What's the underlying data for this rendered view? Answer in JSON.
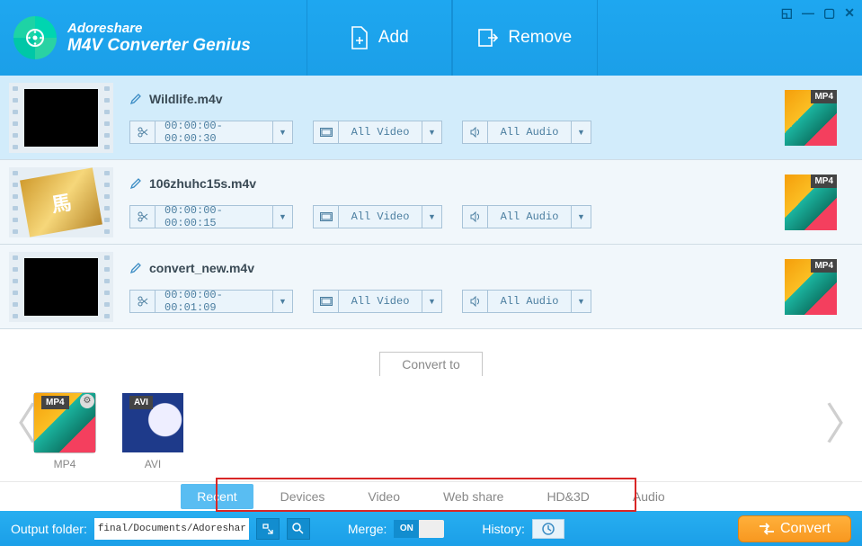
{
  "brand": {
    "line1": "Adoreshare",
    "line2": "M4V Converter Genius"
  },
  "header": {
    "add": "Add",
    "remove": "Remove"
  },
  "files": [
    {
      "name": "Wildlife.m4v",
      "trim": "00:00:00-00:00:30",
      "video": "All Video",
      "audio": "All Audio",
      "format": "MP4",
      "thumb": "black",
      "selected": true
    },
    {
      "name": "106zhuhc15s.m4v",
      "trim": "00:00:00-00:00:15",
      "video": "All Video",
      "audio": "All Audio",
      "format": "MP4",
      "thumb": "gold",
      "selected": false
    },
    {
      "name": "convert_new.m4v",
      "trim": "00:00:00-00:01:09",
      "video": "All Video",
      "audio": "All Audio",
      "format": "MP4",
      "thumb": "black",
      "selected": false
    }
  ],
  "convert_to_label": "Convert to",
  "formats": [
    {
      "code": "MP4",
      "label": "MP4",
      "selected": true,
      "art": "mp4"
    },
    {
      "code": "AVI",
      "label": "AVI",
      "selected": false,
      "art": "avi"
    }
  ],
  "tabs": [
    "Recent",
    "Devices",
    "Video",
    "Web share",
    "HD&3D",
    "Audio"
  ],
  "active_tab": "Recent",
  "footer": {
    "output_label": "Output folder:",
    "output_path": "final/Documents/Adoreshare",
    "merge_label": "Merge:",
    "merge_state": "ON",
    "history_label": "History:",
    "convert": "Convert"
  }
}
